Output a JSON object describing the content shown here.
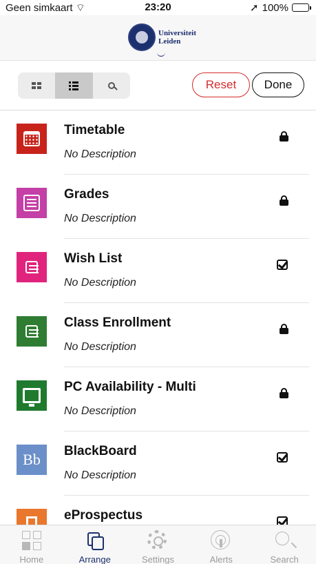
{
  "status": {
    "carrier": "Geen simkaart",
    "time": "23:20",
    "battery": "100%",
    "wifi_icon": "wifi-icon",
    "location_icon": "location-arrow-icon"
  },
  "header": {
    "logo_line1": "Universiteit",
    "logo_line2": "Leiden"
  },
  "toolbar": {
    "views": [
      {
        "icon": "grid-view-icon",
        "active": false
      },
      {
        "icon": "list-view-icon",
        "active": true
      },
      {
        "icon": "search-icon",
        "active": false
      }
    ],
    "reset_label": "Reset",
    "done_label": "Done",
    "reset_color": "#d52b2b"
  },
  "items": [
    {
      "title": "Timetable",
      "desc": "No Description",
      "status": "locked",
      "tile_color": "#c8231b",
      "icon": "calendar-icon"
    },
    {
      "title": "Grades",
      "desc": "No Description",
      "status": "locked",
      "tile_color": "#c43fa6",
      "icon": "grades-icon"
    },
    {
      "title": "Wish List",
      "desc": "No Description",
      "status": "checked",
      "tile_color": "#e0247d",
      "icon": "wish-list-icon"
    },
    {
      "title": "Class Enrollment",
      "desc": "No Description",
      "status": "locked",
      "tile_color": "#2e7d32",
      "icon": "class-enrollment-icon"
    },
    {
      "title": "PC Availability - Multi",
      "desc": "No Description",
      "status": "locked",
      "tile_color": "#1f7a2e",
      "icon": "monitor-icon"
    },
    {
      "title": "BlackBoard",
      "desc": "No Description",
      "status": "checked",
      "tile_color": "#6b8fc8",
      "icon": "blackboard-icon"
    },
    {
      "title": "eProspectus",
      "desc": "",
      "status": "checked",
      "tile_color": "#e9772d",
      "icon": "bookmark-icon"
    }
  ],
  "tabs": [
    {
      "label": "Home",
      "active": false
    },
    {
      "label": "Arrange",
      "active": true
    },
    {
      "label": "Settings",
      "active": false
    },
    {
      "label": "Alerts",
      "active": false
    },
    {
      "label": "Search",
      "active": false
    }
  ]
}
